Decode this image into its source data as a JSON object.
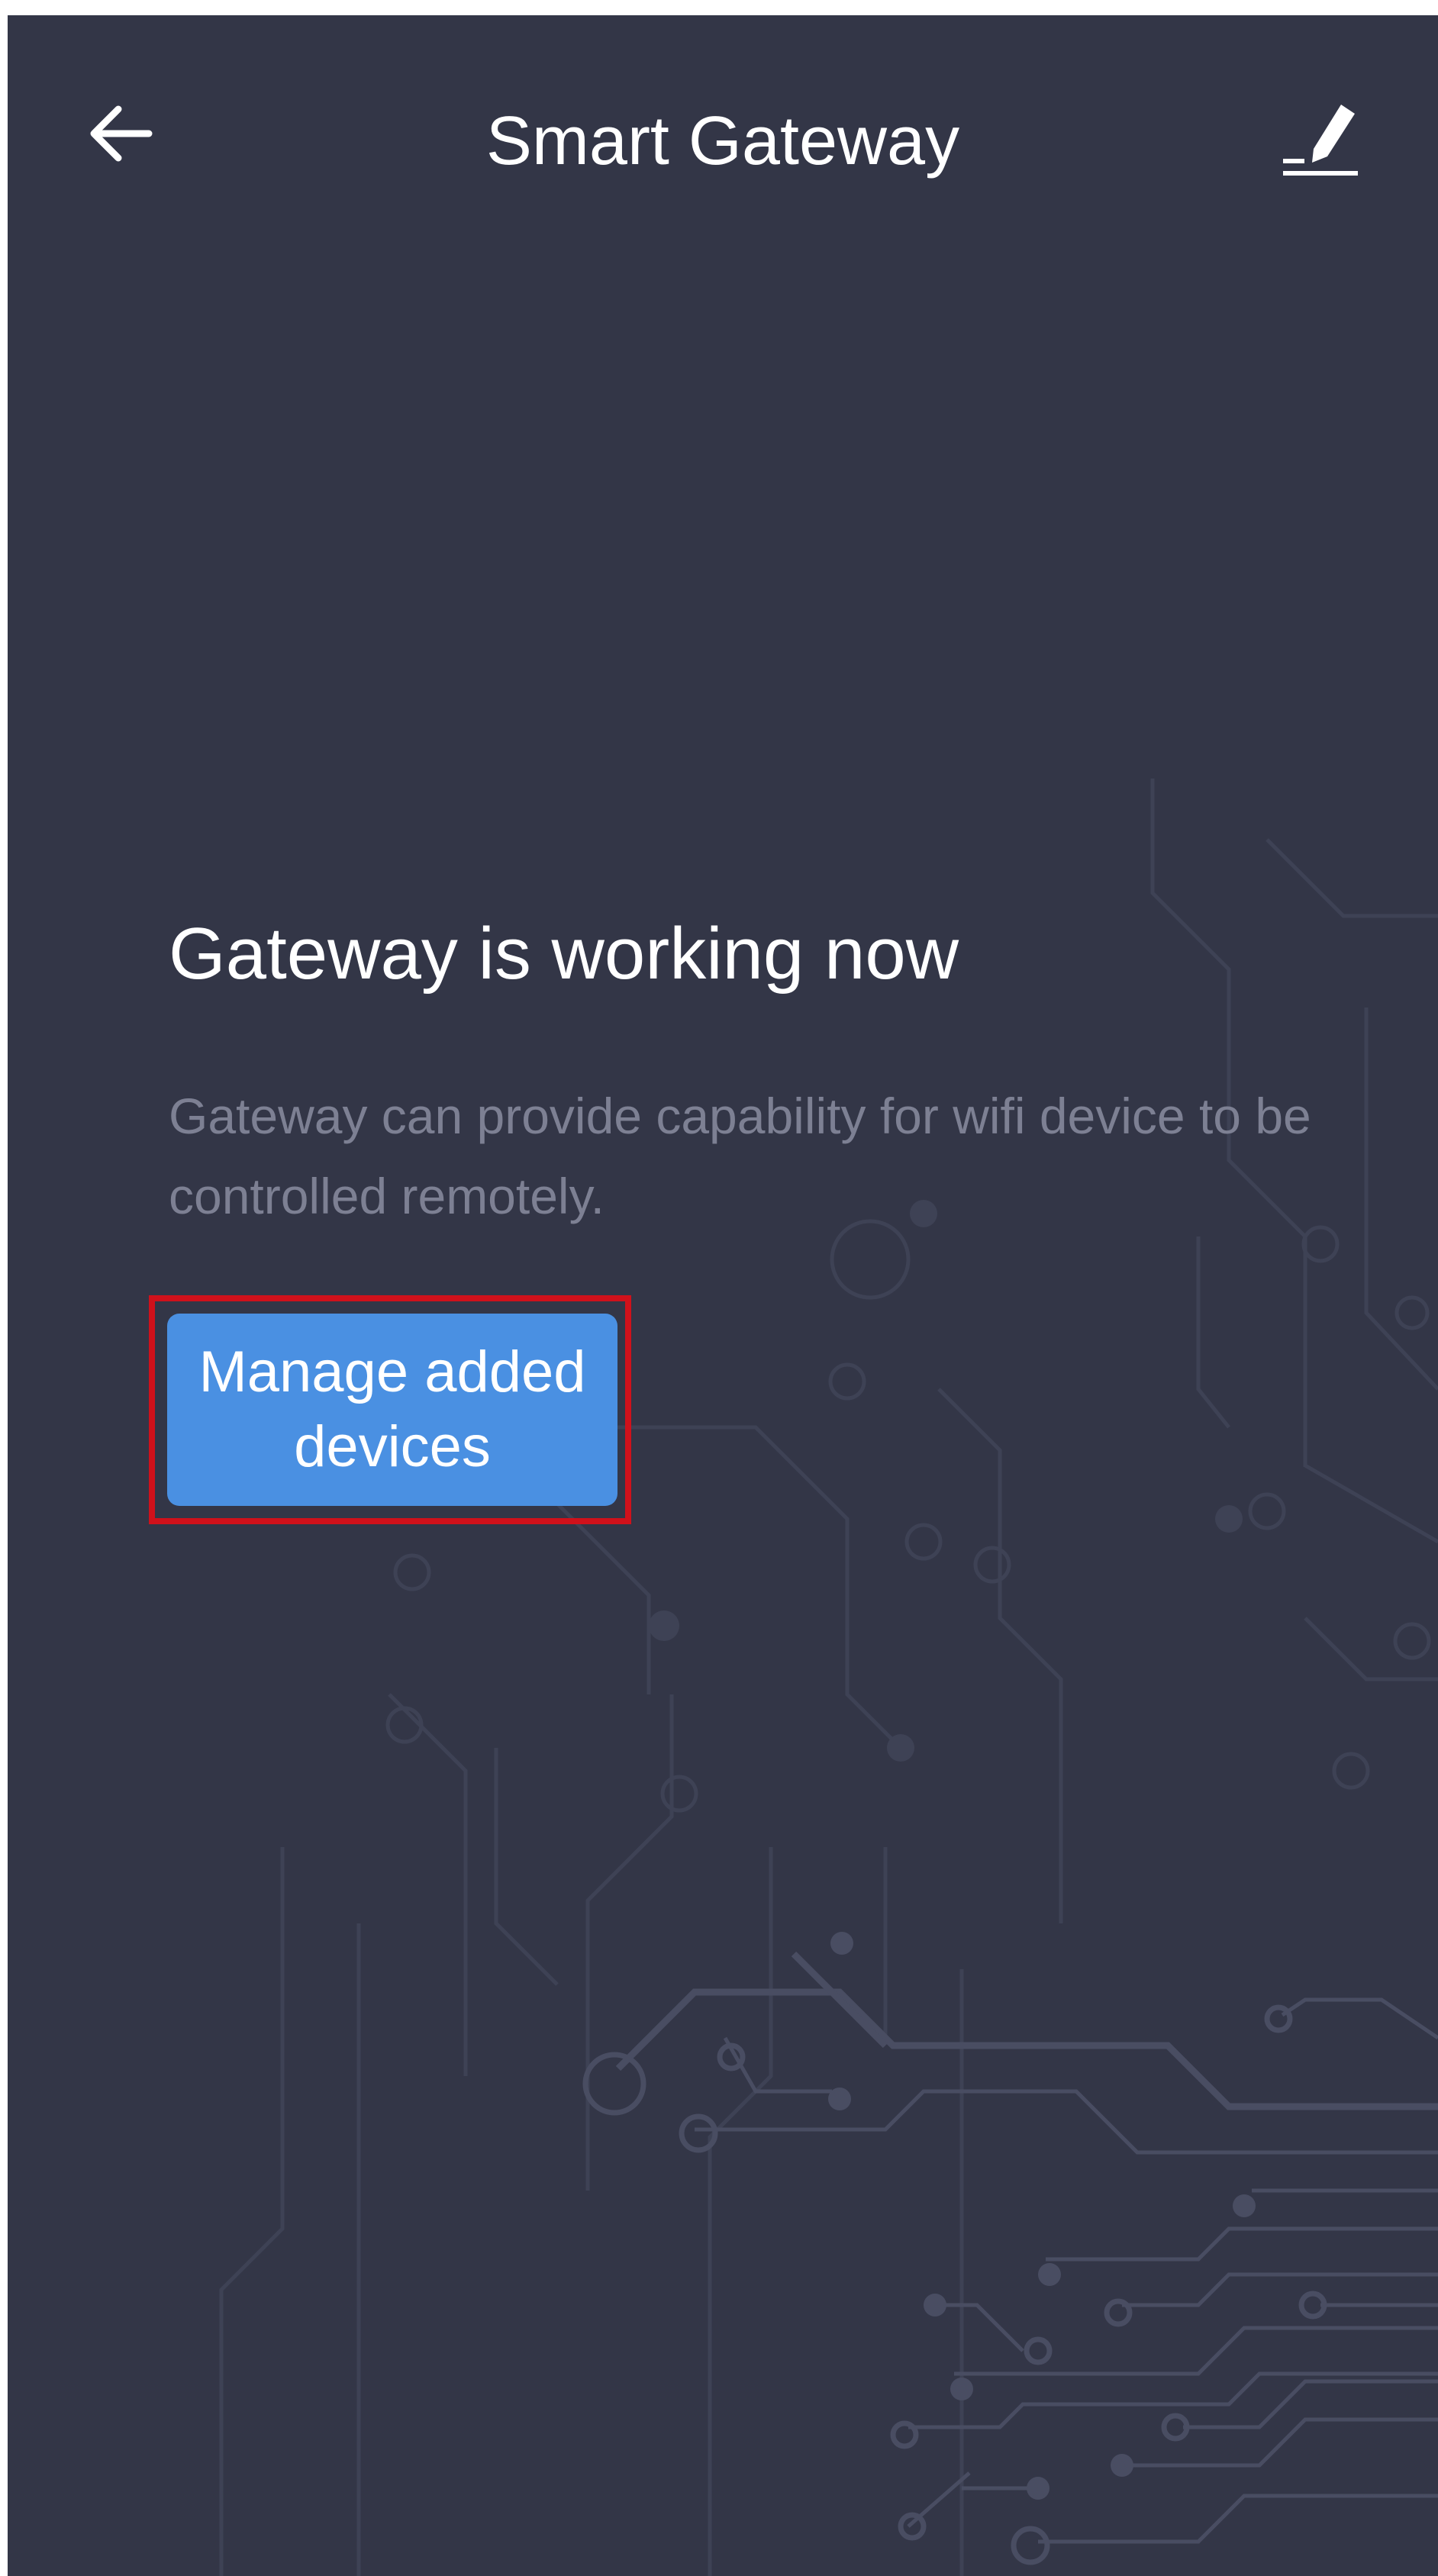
{
  "header": {
    "title": "Smart Gateway",
    "back_icon": "arrow-left-icon",
    "edit_icon": "pencil-icon"
  },
  "status": {
    "headline": "Gateway is working now",
    "description": "Gateway can provide capability for wifi device to be controlled remotely."
  },
  "actions": {
    "manage_label": "Manage added devices"
  },
  "colors": {
    "background": "#333647",
    "button": "#4a90e2",
    "highlight": "#d0111b",
    "description_text": "#7d8093"
  }
}
